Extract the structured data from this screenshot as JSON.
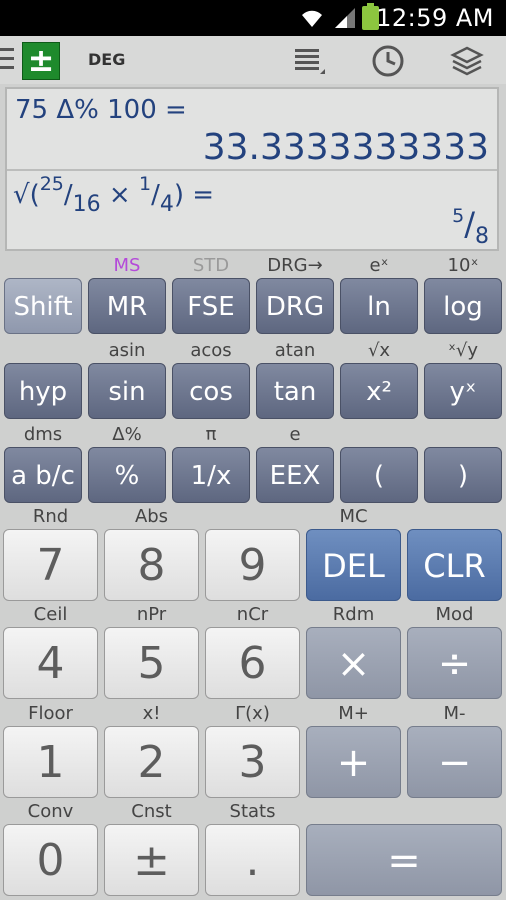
{
  "status_bar": {
    "time": "12:59 AM"
  },
  "toolbar": {
    "angle_mode": "DEG"
  },
  "display": {
    "expr1": "75 Δ% 100 =",
    "result1": "33.3333333333",
    "expr2_open": "√(",
    "expr2_n1": "25",
    "expr2_d1": "16",
    "expr2_times": " × ",
    "expr2_n2": "1",
    "expr2_d2": "4",
    "expr2_close": ") =",
    "result2_num": "5",
    "result2_den": "8"
  },
  "sci_rows": [
    [
      {
        "secondary": "",
        "label": "Shift",
        "style": "shift"
      },
      {
        "secondary": "MS",
        "label": "MR",
        "style": "dark",
        "sec_color": "#b44ad9"
      },
      {
        "secondary": "STD",
        "label": "FSE",
        "style": "dark",
        "sec_color": "#9a9a9a"
      },
      {
        "secondary": "DRG→",
        "label": "DRG",
        "style": "dark"
      },
      {
        "secondary": "eˣ",
        "label": "ln",
        "style": "dark"
      },
      {
        "secondary": "10ˣ",
        "label": "log",
        "style": "dark"
      }
    ],
    [
      {
        "secondary": "",
        "label": "hyp",
        "style": "dark"
      },
      {
        "secondary": "asin",
        "label": "sin",
        "style": "dark"
      },
      {
        "secondary": "acos",
        "label": "cos",
        "style": "dark"
      },
      {
        "secondary": "atan",
        "label": "tan",
        "style": "dark"
      },
      {
        "secondary": "√x",
        "label": "x²",
        "style": "dark"
      },
      {
        "secondary": "ˣ√y",
        "label": "yˣ",
        "style": "dark"
      }
    ],
    [
      {
        "secondary": "dms",
        "label": "a b/c",
        "style": "dark"
      },
      {
        "secondary": "Δ%",
        "label": "%",
        "style": "dark"
      },
      {
        "secondary": "π",
        "label": "1/x",
        "style": "dark"
      },
      {
        "secondary": "e",
        "label": "EEX",
        "style": "dark"
      },
      {
        "secondary": "",
        "label": "(",
        "style": "dark"
      },
      {
        "secondary": "",
        "label": ")",
        "style": "dark"
      }
    ]
  ],
  "num_rows": [
    [
      {
        "secondary": "Rnd",
        "label": "7",
        "style": "white"
      },
      {
        "secondary": "Abs",
        "label": "8",
        "style": "white"
      },
      {
        "secondary": "",
        "label": "9",
        "style": "white"
      },
      {
        "secondary": "MC",
        "label": "DEL",
        "style": "blue"
      },
      {
        "secondary": "",
        "label": "CLR",
        "style": "blue"
      }
    ],
    [
      {
        "secondary": "Ceil",
        "label": "4",
        "style": "white"
      },
      {
        "secondary": "nPr",
        "label": "5",
        "style": "white"
      },
      {
        "secondary": "nCr",
        "label": "6",
        "style": "white"
      },
      {
        "secondary": "Rdm",
        "label": "×",
        "style": "op"
      },
      {
        "secondary": "Mod",
        "label": "÷",
        "style": "op"
      }
    ],
    [
      {
        "secondary": "Floor",
        "label": "1",
        "style": "white"
      },
      {
        "secondary": "x!",
        "label": "2",
        "style": "white"
      },
      {
        "secondary": "Γ(x)",
        "label": "3",
        "style": "white"
      },
      {
        "secondary": "M+",
        "label": "+",
        "style": "op"
      },
      {
        "secondary": "M-",
        "label": "−",
        "style": "op"
      }
    ],
    [
      {
        "secondary": "Conv",
        "label": "0",
        "style": "white"
      },
      {
        "secondary": "Cnst",
        "label": "±",
        "style": "white"
      },
      {
        "secondary": "Stats",
        "label": ".",
        "style": "white"
      },
      {
        "secondary": "",
        "label": "=",
        "style": "op",
        "span": 2
      }
    ]
  ]
}
